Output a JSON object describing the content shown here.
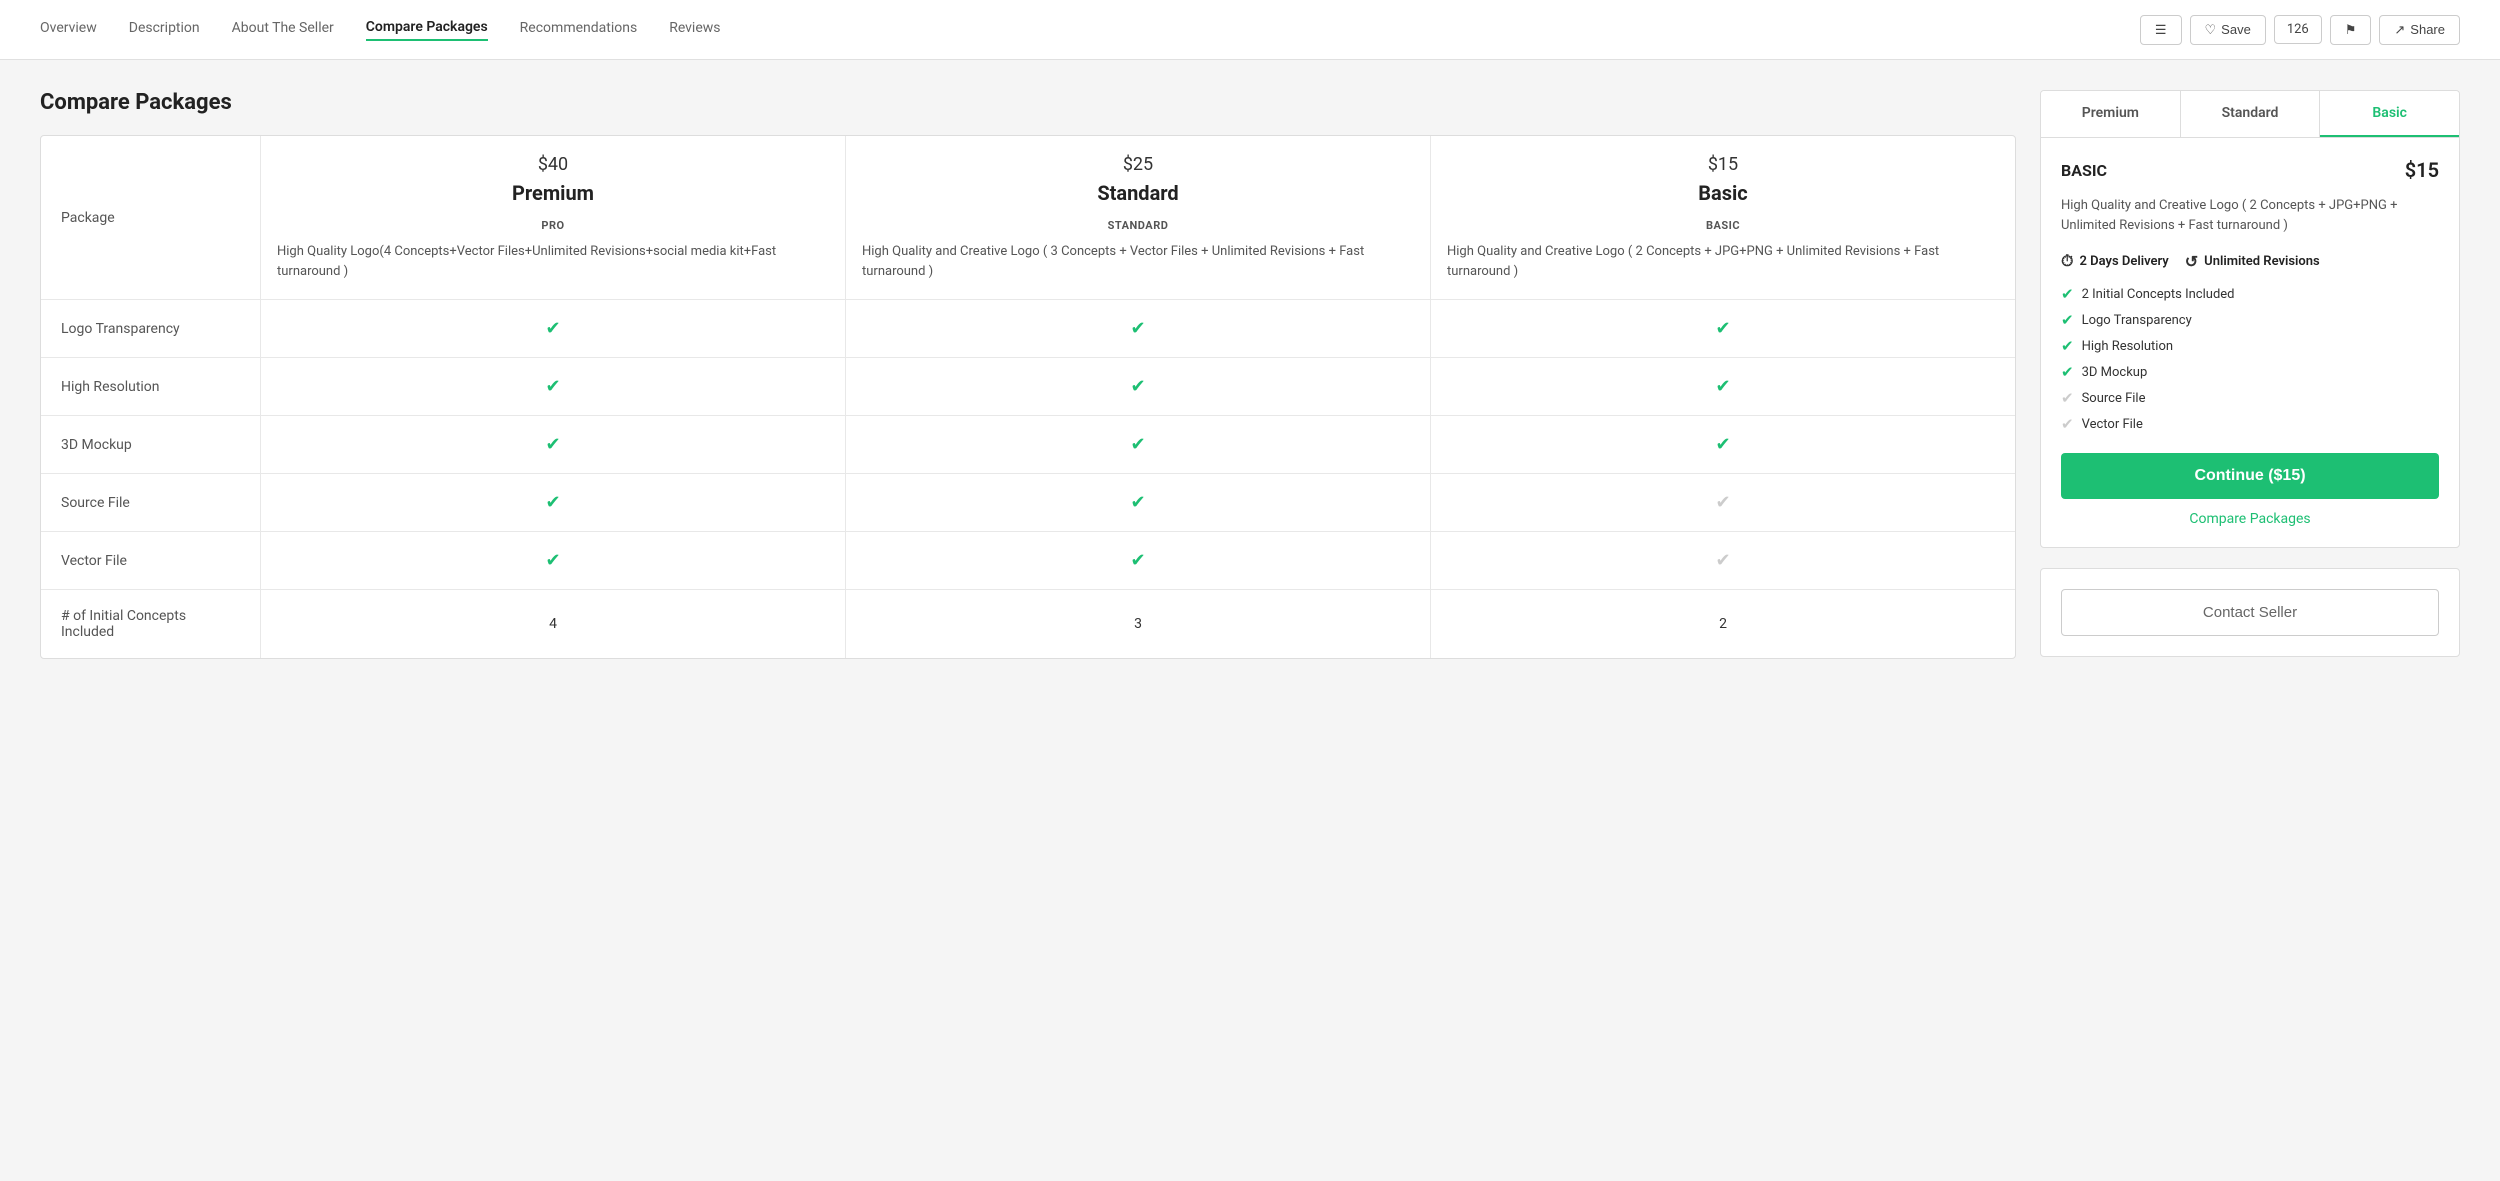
{
  "nav": {
    "links": [
      {
        "label": "Overview",
        "active": false
      },
      {
        "label": "Description",
        "active": false
      },
      {
        "label": "About The Seller",
        "active": false
      },
      {
        "label": "Compare Packages",
        "active": true
      },
      {
        "label": "Recommendations",
        "active": false
      },
      {
        "label": "Reviews",
        "active": false
      }
    ],
    "save_label": "Save",
    "count": "126",
    "share_label": "Share"
  },
  "section_title": "Compare Packages",
  "table": {
    "col_label": "Package",
    "packages": [
      {
        "price": "$40",
        "name": "Premium",
        "tier": "PRO",
        "description": "High Quality Logo(4 Concepts+Vector Files+Unlimited Revisions+social media kit+Fast turnaround )"
      },
      {
        "price": "$25",
        "name": "Standard",
        "tier": "STANDARD",
        "description": "High Quality and Creative Logo ( 3 Concepts + Vector Files + Unlimited Revisions + Fast turnaround )"
      },
      {
        "price": "$15",
        "name": "Basic",
        "tier": "BASIC",
        "description": "High Quality and Creative Logo ( 2 Concepts + JPG+PNG + Unlimited Revisions + Fast turnaround )"
      }
    ],
    "rows": [
      {
        "label": "Logo Transparency",
        "values": [
          "check",
          "check",
          "check"
        ]
      },
      {
        "label": "High Resolution",
        "values": [
          "check",
          "check",
          "check"
        ]
      },
      {
        "label": "3D Mockup",
        "values": [
          "check",
          "check",
          "check"
        ]
      },
      {
        "label": "Source File",
        "values": [
          "check",
          "check",
          "gray"
        ]
      },
      {
        "label": "Vector File",
        "values": [
          "check",
          "check",
          "gray"
        ]
      },
      {
        "label": "# of Initial Concepts Included",
        "values": [
          "4",
          "3",
          "2"
        ]
      }
    ]
  },
  "card": {
    "tabs": [
      {
        "label": "Premium",
        "active": false
      },
      {
        "label": "Standard",
        "active": false
      },
      {
        "label": "Basic",
        "active": true
      }
    ],
    "title": "BASIC",
    "price": "$15",
    "description": "High Quality and Creative Logo ( 2 Concepts + JPG+PNG + Unlimited Revisions + Fast turnaround )",
    "delivery": "2 Days Delivery",
    "revisions": "Unlimited Revisions",
    "features": [
      {
        "label": "2 Initial Concepts Included",
        "included": true
      },
      {
        "label": "Logo Transparency",
        "included": true
      },
      {
        "label": "High Resolution",
        "included": true
      },
      {
        "label": "3D Mockup",
        "included": true
      },
      {
        "label": "Source File",
        "included": false
      },
      {
        "label": "Vector File",
        "included": false
      }
    ],
    "continue_btn": "Continue ($15)",
    "compare_link": "Compare Packages",
    "contact_btn": "Contact Seller"
  }
}
